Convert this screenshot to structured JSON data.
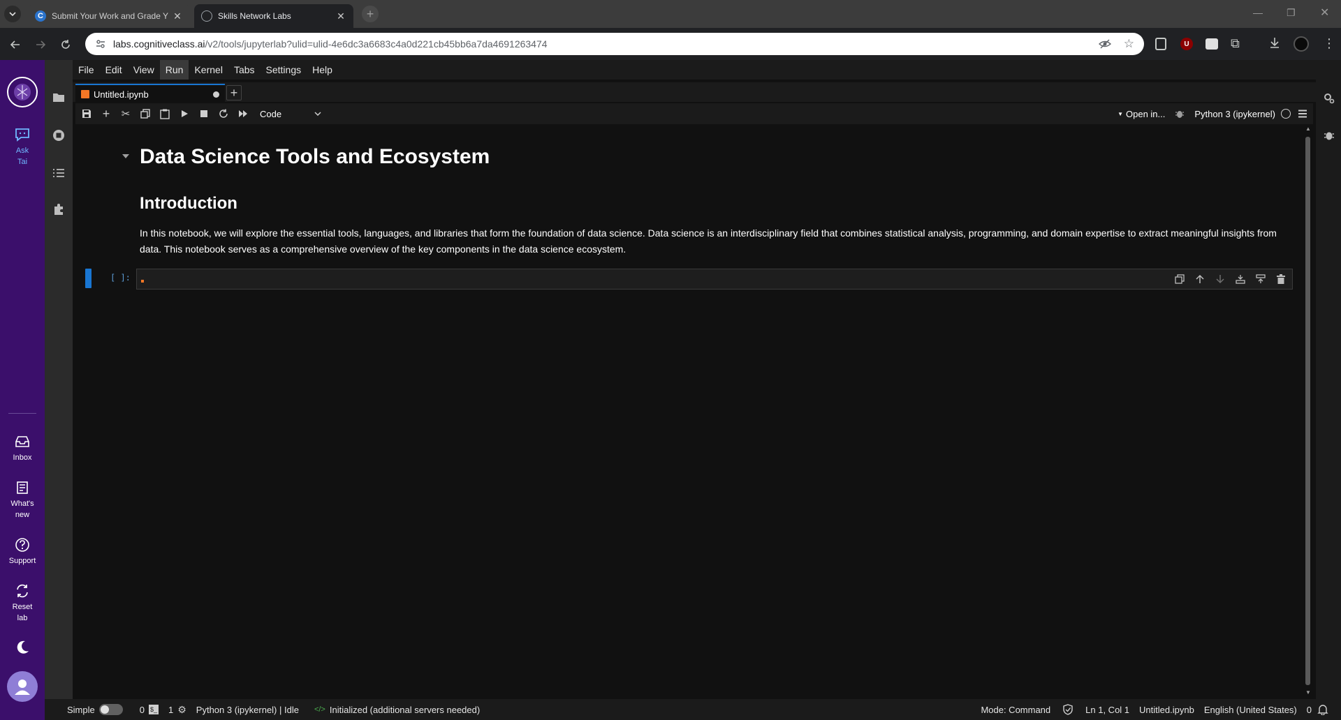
{
  "browser": {
    "tabs": [
      {
        "title": "Submit Your Work and Grade Y",
        "active": false
      },
      {
        "title": "Skills Network Labs",
        "active": true
      }
    ],
    "url": {
      "host": "labs.cognitiveclass.ai",
      "path": "/v2/tools/jupyterlab?ulid=ulid-4e6dc3a6683c4a0d221cb45bb6a7da4691263474"
    }
  },
  "sidebar": {
    "ask_tai": "Ask Tai",
    "inbox": "Inbox",
    "whats_new": "What's new",
    "support": "Support",
    "reset_lab": "Reset lab"
  },
  "menu": [
    "File",
    "Edit",
    "View",
    "Run",
    "Kernel",
    "Tabs",
    "Settings",
    "Help"
  ],
  "menu_active": "Run",
  "doc_tab": {
    "title": "Untitled.ipynb"
  },
  "nb_toolbar": {
    "cell_type": "Code",
    "open_in": "Open in...",
    "kernel": "Python 3 (ipykernel)"
  },
  "notebook": {
    "h1": "Data Science Tools and Ecosystem",
    "h2": "Introduction",
    "paragraph": "In this notebook, we will explore the essential tools, languages, and libraries that form the foundation of data science. Data science is an interdisciplinary field that combines statistical analysis, programming, and domain expertise to extract meaningful insights from data. This notebook serves as a comprehensive overview of the key components in the data science ecosystem.",
    "prompt": "[ ]:"
  },
  "status": {
    "simple": "Simple",
    "count0": "0",
    "count1": "1",
    "kernel": "Python 3 (ipykernel) | Idle",
    "lsp": "Initialized (additional servers needed)",
    "mode": "Mode: Command",
    "position": "Ln 1, Col 1",
    "file": "Untitled.ipynb",
    "language": "English (United States)",
    "notifications": "0"
  },
  "colors": {
    "accent": "#1976d2",
    "sidebar": "#3b0f6b",
    "jupyter_orange": "#f37726"
  }
}
